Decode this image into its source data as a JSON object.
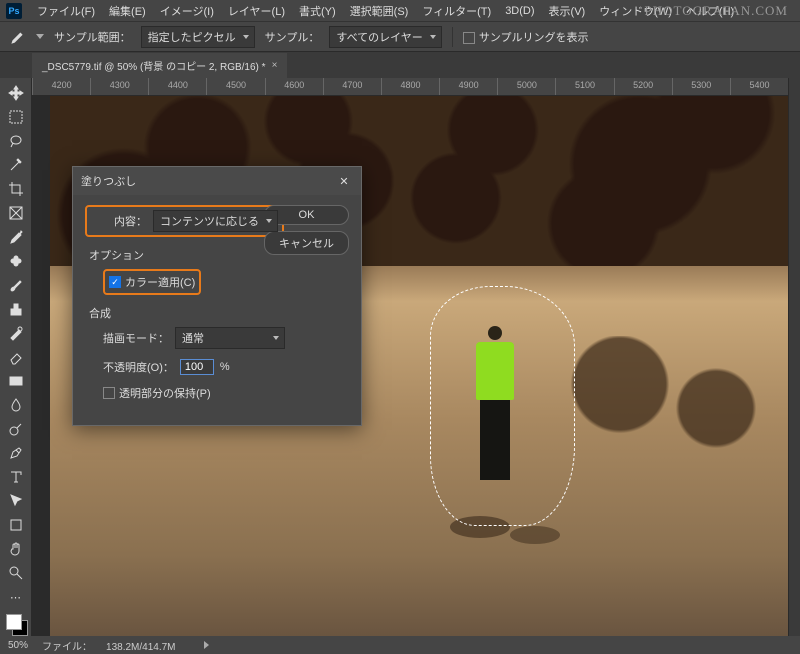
{
  "watermark": "PHOTOGRAFAN.COM",
  "menubar": {
    "items": [
      "ファイル(F)",
      "編集(E)",
      "イメージ(I)",
      "レイヤー(L)",
      "書式(Y)",
      "選択範囲(S)",
      "フィルター(T)",
      "3D(D)",
      "表示(V)",
      "ウィンドウ(W)",
      "ヘルプ(H)"
    ]
  },
  "optbar": {
    "sample_range_label": "サンプル範囲：",
    "sample_range_value": "指定したピクセル",
    "sample_label": "サンプル：",
    "sample_value": "すべてのレイヤー",
    "samplering_label": "サンプルリングを表示"
  },
  "tab": {
    "label": "_DSC5779.tif @ 50% (背景 のコピー 2, RGB/16) *"
  },
  "ruler_ticks": [
    "4200",
    "4300",
    "4400",
    "4500",
    "4600",
    "4700",
    "4800",
    "4900",
    "5000",
    "5100",
    "5200",
    "5300",
    "5400"
  ],
  "dialog": {
    "title": "塗りつぶし",
    "content_label": "内容：",
    "content_value": "コンテンツに応じる",
    "ok": "OK",
    "cancel": "キャンセル",
    "options_label": "オプション",
    "color_adapt_label": "カラー適用(C)",
    "compose_label": "合成",
    "mode_label": "描画モード：",
    "mode_value": "通常",
    "opacity_label": "不透明度(O)：",
    "opacity_value": "100",
    "percent": "%",
    "preserve_trans_label": "透明部分の保持(P)"
  },
  "status": {
    "zoom": "50%",
    "filesize_label": "ファイル：",
    "filesize_value": "138.2M/414.7M"
  }
}
